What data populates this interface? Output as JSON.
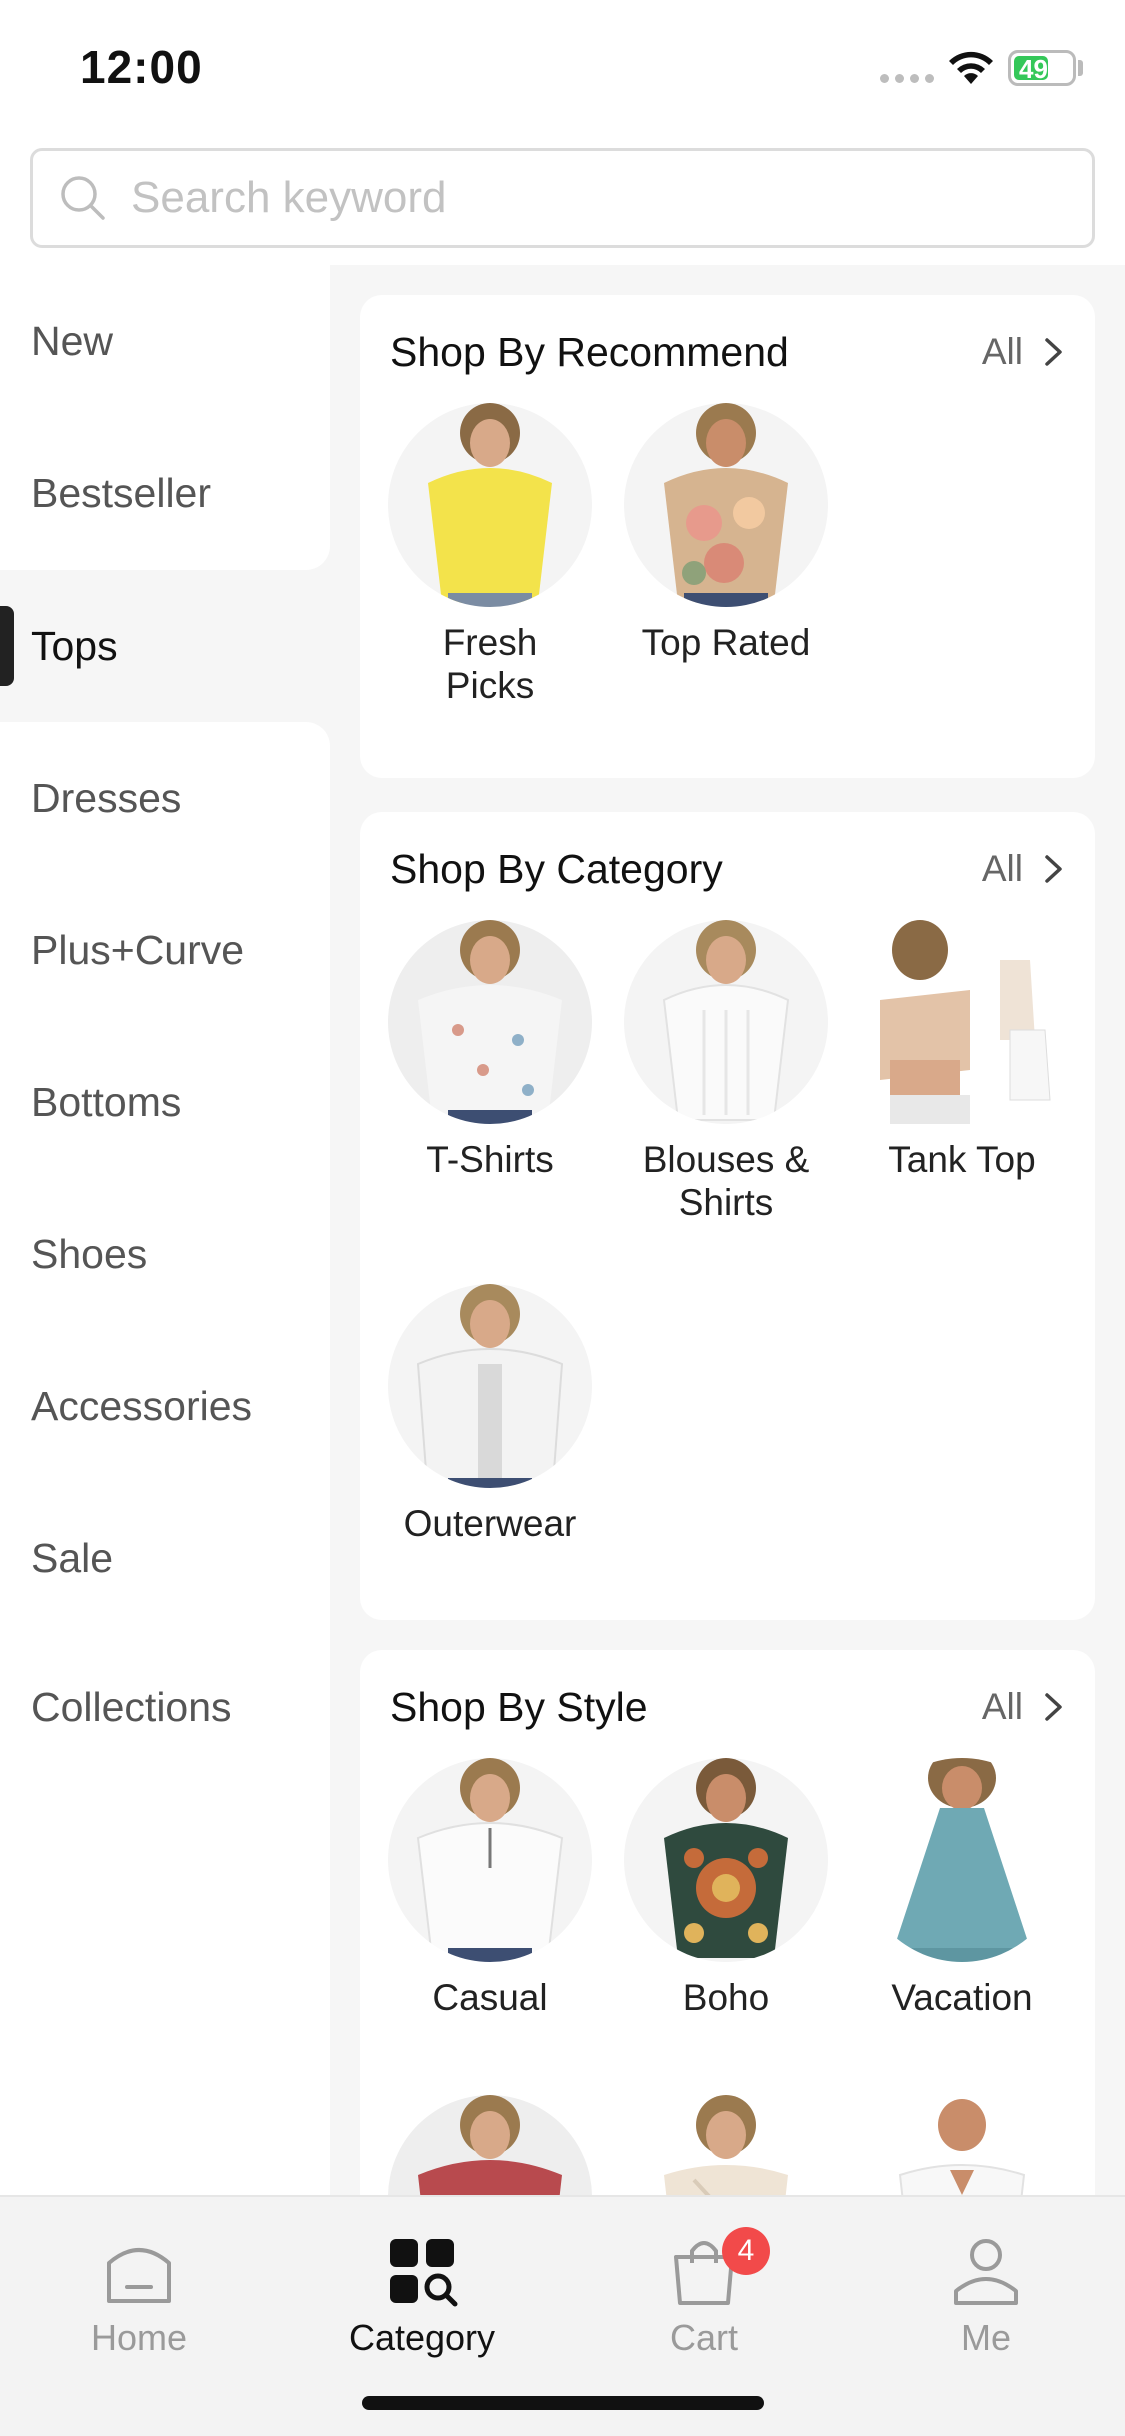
{
  "status_bar": {
    "time": "12:00",
    "battery": "49"
  },
  "search": {
    "placeholder": "Search keyword"
  },
  "sidebar": {
    "items": [
      {
        "label": "New"
      },
      {
        "label": "Bestseller"
      },
      {
        "label": "Tops",
        "active": true
      },
      {
        "label": "Dresses"
      },
      {
        "label": "Plus+Curve"
      },
      {
        "label": "Bottoms"
      },
      {
        "label": "Shoes"
      },
      {
        "label": "Accessories"
      },
      {
        "label": "Sale"
      },
      {
        "label": "Collections"
      }
    ]
  },
  "sections": [
    {
      "title": "Shop By Recommend",
      "all_label": "All",
      "items": [
        {
          "label": "Fresh Picks",
          "image": "yellow-top-photo"
        },
        {
          "label": "Top Rated",
          "image": "floral-top-photo"
        }
      ]
    },
    {
      "title": "Shop By Category",
      "all_label": "All",
      "items": [
        {
          "label": "T-Shirts",
          "image": "floral-white-tee-photo"
        },
        {
          "label": "Blouses & Shirts",
          "image": "white-blouse-photo"
        },
        {
          "label": "Tank Top",
          "image": "tank-top-photo"
        },
        {
          "label": "Outerwear",
          "image": "white-cardigan-photo"
        }
      ]
    },
    {
      "title": "Shop By Style",
      "all_label": "All",
      "items": [
        {
          "label": "Casual",
          "image": "white-zip-top-photo"
        },
        {
          "label": "Boho",
          "image": "boho-print-top-photo"
        },
        {
          "label": "Vacation",
          "image": "teal-halter-top-photo"
        },
        {
          "label": "",
          "image": "red-paisley-top-photo"
        },
        {
          "label": "",
          "image": "wrap-top-photo"
        },
        {
          "label": "",
          "image": "white-vneck-photo"
        }
      ]
    }
  ],
  "tabbar": {
    "tabs": [
      {
        "label": "Home",
        "icon": "home-icon"
      },
      {
        "label": "Category",
        "icon": "category-icon",
        "active": true
      },
      {
        "label": "Cart",
        "icon": "cart-icon",
        "badge": "4"
      },
      {
        "label": "Me",
        "icon": "profile-icon"
      }
    ]
  },
  "colors": {
    "accent": "#111111",
    "badge": "#f24a4a",
    "battery": "#34c759"
  }
}
